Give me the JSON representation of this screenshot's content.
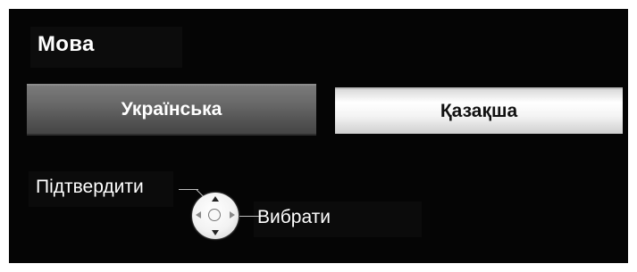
{
  "menu": {
    "title": "Мова"
  },
  "languages": [
    {
      "label": "Українська",
      "state": "focused"
    },
    {
      "label": "Қазақша",
      "state": "selected"
    }
  ],
  "hints": {
    "confirm_label": "Підтвердити",
    "select_label": "Вибрати"
  },
  "icons": {
    "navigation": "dpad-icon"
  },
  "colors": {
    "background": "#050505",
    "focused_option": "#666666",
    "selected_option": "#f4f4f4",
    "text_light": "#ffffff",
    "text_dark": "#111111"
  }
}
